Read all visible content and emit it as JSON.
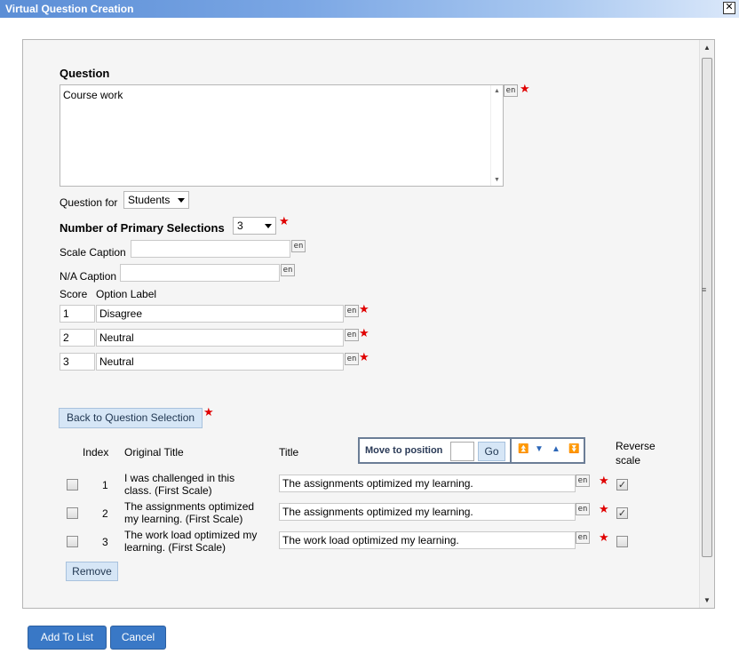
{
  "window": {
    "title": "Virtual Question Creation",
    "close_icon": "close-icon"
  },
  "form": {
    "question_label": "Question",
    "question_text": "Course work",
    "question_for_label": "Question for",
    "question_for_value": "Students",
    "primary_label": "Number of Primary Selections",
    "primary_value": "3",
    "scale_caption_label": "Scale Caption",
    "scale_caption_value": "",
    "na_caption_label": "N/A Caption",
    "na_caption_value": "",
    "score_header": "Score",
    "option_label_header": "Option Label",
    "options": [
      {
        "score": "1",
        "label": "Disagree"
      },
      {
        "score": "2",
        "label": "Neutral"
      },
      {
        "score": "3",
        "label": "Neutral"
      }
    ],
    "lang_tag": "en",
    "required_star": "★"
  },
  "selection": {
    "back_button": "Back to Question Selection",
    "headers": {
      "index": "Index",
      "original": "Original Title",
      "title": "Title",
      "reverse1": "Reverse",
      "reverse2": "scale"
    },
    "move_label": "Move to position",
    "move_value": "",
    "go_button": "Go",
    "rows": [
      {
        "index": "1",
        "orig1": "I was challenged in this",
        "orig2": "class. (First Scale)",
        "title": "The assignments optimized my learning.",
        "reverse": true
      },
      {
        "index": "2",
        "orig1": "The assignments optimized",
        "orig2": "my learning. (First Scale)",
        "title": "The assignments optimized my learning.",
        "reverse": true
      },
      {
        "index": "3",
        "orig1": "The work load optimized my",
        "orig2": "learning. (First Scale)",
        "title": "The work load optimized my learning.",
        "reverse": false
      }
    ],
    "remove_button": "Remove"
  },
  "footer": {
    "add_button": "Add To List",
    "cancel_button": "Cancel"
  }
}
